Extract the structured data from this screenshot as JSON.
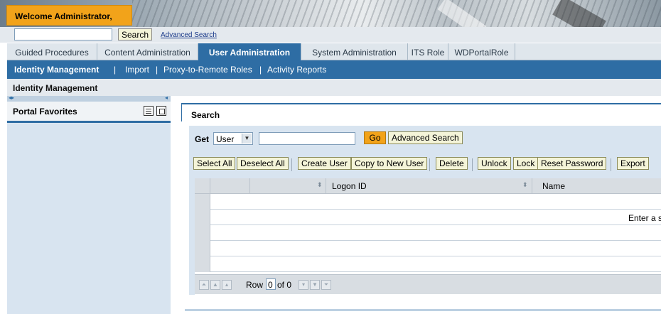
{
  "header": {
    "welcome": "Welcome Administrator,"
  },
  "search": {
    "value": "",
    "button": "Search",
    "advanced": "Advanced Search"
  },
  "top_tabs": [
    "Guided Procedures",
    "Content Administration",
    "User Administration",
    "System Administration",
    "ITS Role",
    "WDPortalRole"
  ],
  "top_tab_selected": "User Administration",
  "sub_tabs": [
    "Identity Management",
    "Import",
    "Proxy-to-Remote Roles",
    "Activity Reports"
  ],
  "sub_tab_selected": "Identity Management",
  "sub_separator": "|",
  "page_title": "Identity Management",
  "nav": {
    "title": "Portal Favorites"
  },
  "main": {
    "section_title": "Search",
    "get_label": "Get",
    "type_select": "User",
    "query_value": "",
    "go_button": "Go",
    "advanced_button": "Advanced Search",
    "toolbar": [
      "Select All",
      "Deselect All",
      "Create User",
      "Copy to New User",
      "Delete",
      "Unlock",
      "Lock",
      "Reset Password",
      "Export"
    ],
    "columns": [
      "Logon ID",
      "Name"
    ],
    "empty_message": "Enter a s",
    "pager": {
      "row_label": "Row",
      "row_value": "0",
      "of_label": "of 0"
    }
  }
}
